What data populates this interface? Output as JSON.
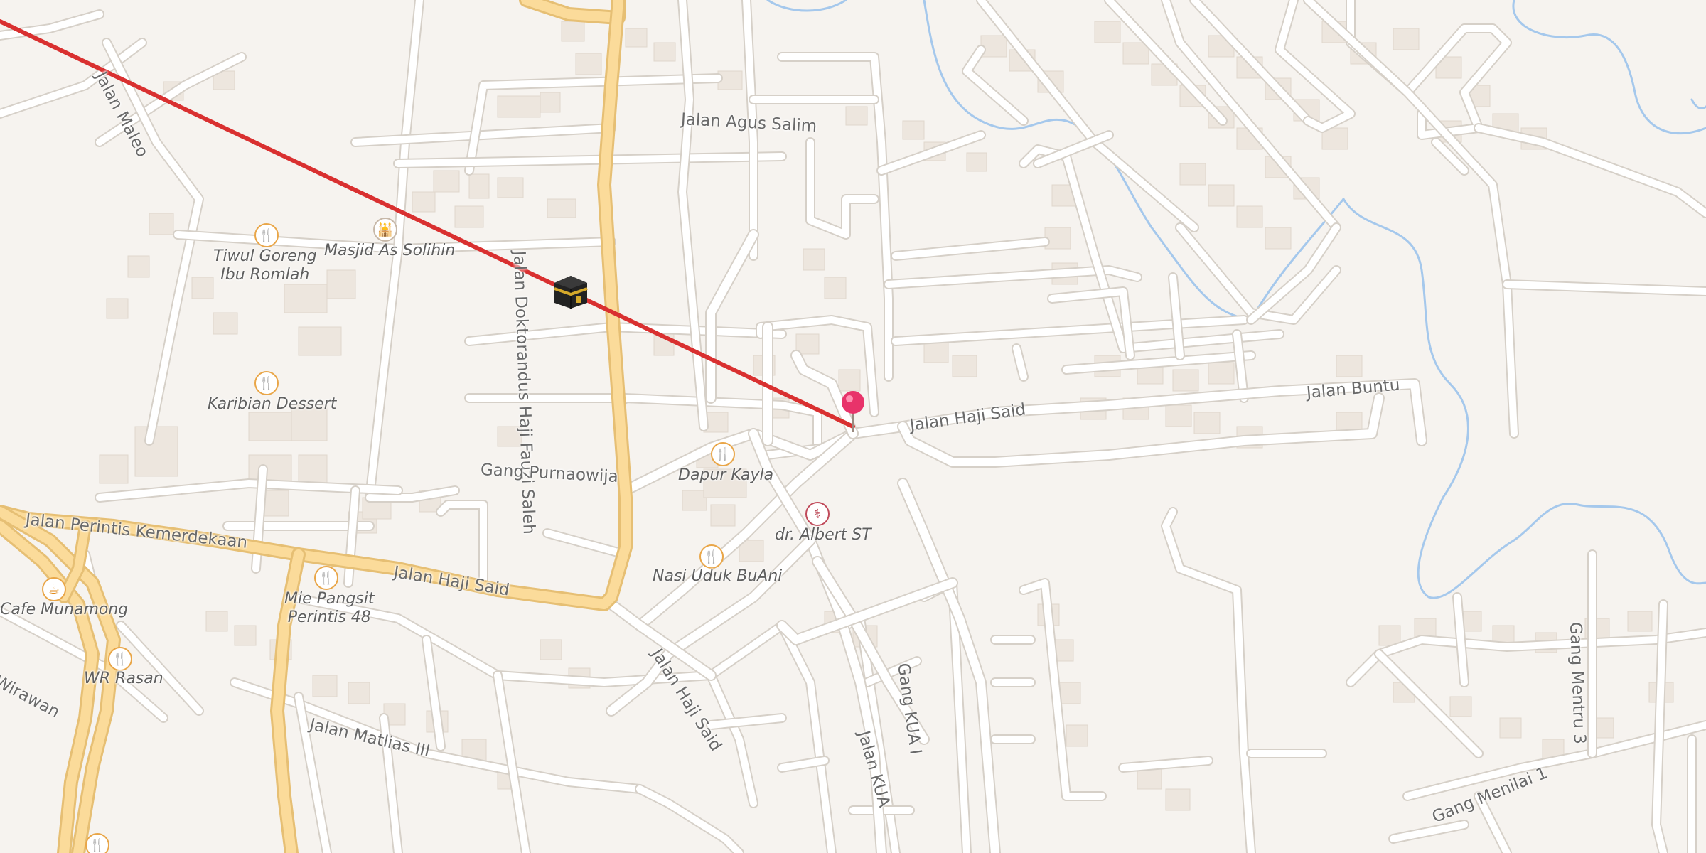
{
  "map": {
    "qibla_line_color": "#d93030",
    "major_road_color": "#fbdb9a",
    "water_color": "#a5c8ec",
    "marker_color": "#e8336a"
  },
  "roads": {
    "jalan_maleo": "Jalan Maleo",
    "jalan_agus_salim": "Jalan Agus Salim",
    "jalan_dokt_fauzi": "Jalan Doktorandus Haji Fauzi Saleh",
    "jalan_haji_said_1": "Jalan Haji Said",
    "jalan_haji_said_2": "Jalan Haji Said",
    "jalan_haji_said_3": "Jalan Haji Said",
    "jalan_buntu": "Jalan Buntu",
    "gang_purnaowija": "Gang Purnaowija",
    "jalan_perintis": "Jalan Perintis Kemerdekaan",
    "jalan_matlias": "Jalan Matlias III",
    "gang_kua_1": "Gang KUA I",
    "jalan_kua": "Jalan KUA",
    "gang_menilai": "Gang Menilai 1",
    "gang_mentru": "Gang Mentru 3",
    "wirawan": "Wirawan"
  },
  "pois": [
    {
      "name": "Tiwul Goreng\nIbu Romlah",
      "icon": "restaurant-icon"
    },
    {
      "name": "Masjid As Solihin",
      "icon": "mosque-icon"
    },
    {
      "name": "Karibian Dessert",
      "icon": "restaurant-icon"
    },
    {
      "name": "Dapur Kayla",
      "icon": "restaurant-icon"
    },
    {
      "name": "dr. Albert ST",
      "icon": "doctor-icon"
    },
    {
      "name": "Nasi Uduk BuAni",
      "icon": "restaurant-icon"
    },
    {
      "name": "Mie Pangsit\nPerintis 48",
      "icon": "restaurant-icon"
    },
    {
      "name": "Cafe Munamong",
      "icon": "cafe-icon"
    },
    {
      "name": "WR Rasan",
      "icon": "restaurant-icon"
    }
  ]
}
